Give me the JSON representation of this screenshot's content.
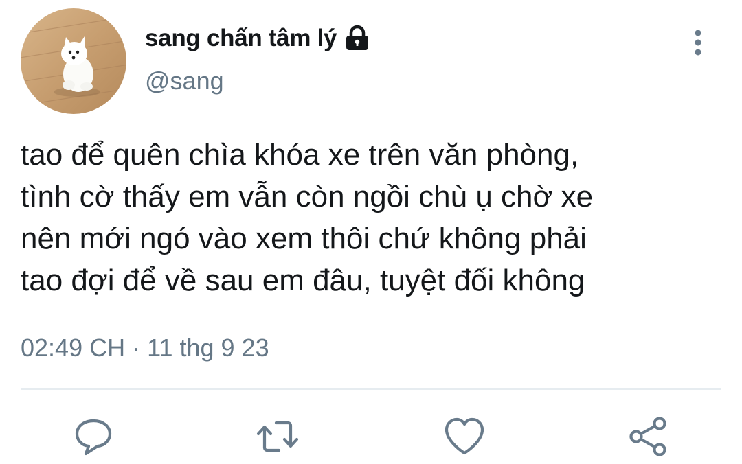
{
  "tweet": {
    "author": {
      "display_name": "sang chấn tâm lý",
      "handle": "@sang",
      "protected_icon": "lock-icon",
      "avatar": "white-puppy-on-wood-floor"
    },
    "text_lines": [
      "tao để quên chìa khóa xe trên văn phòng,",
      "tình cờ thấy em vẫn còn ngồi chù ụ chờ xe",
      "nên mới ngó vào xem thôi chứ không phải",
      "tao đợi để về sau em đâu, tuyệt đối không"
    ],
    "time": "02:49 CH",
    "separator": "·",
    "date": "11 thg 9 23"
  },
  "actions": {
    "reply_icon": "reply-icon",
    "retweet_icon": "retweet-icon",
    "like_icon": "heart-icon",
    "share_icon": "share-icon",
    "more_icon": "more-vertical-icon"
  },
  "colors": {
    "text": "#14171a",
    "secondary": "#657786",
    "icon": "#697b8b",
    "divider": "#e6ecf0"
  }
}
